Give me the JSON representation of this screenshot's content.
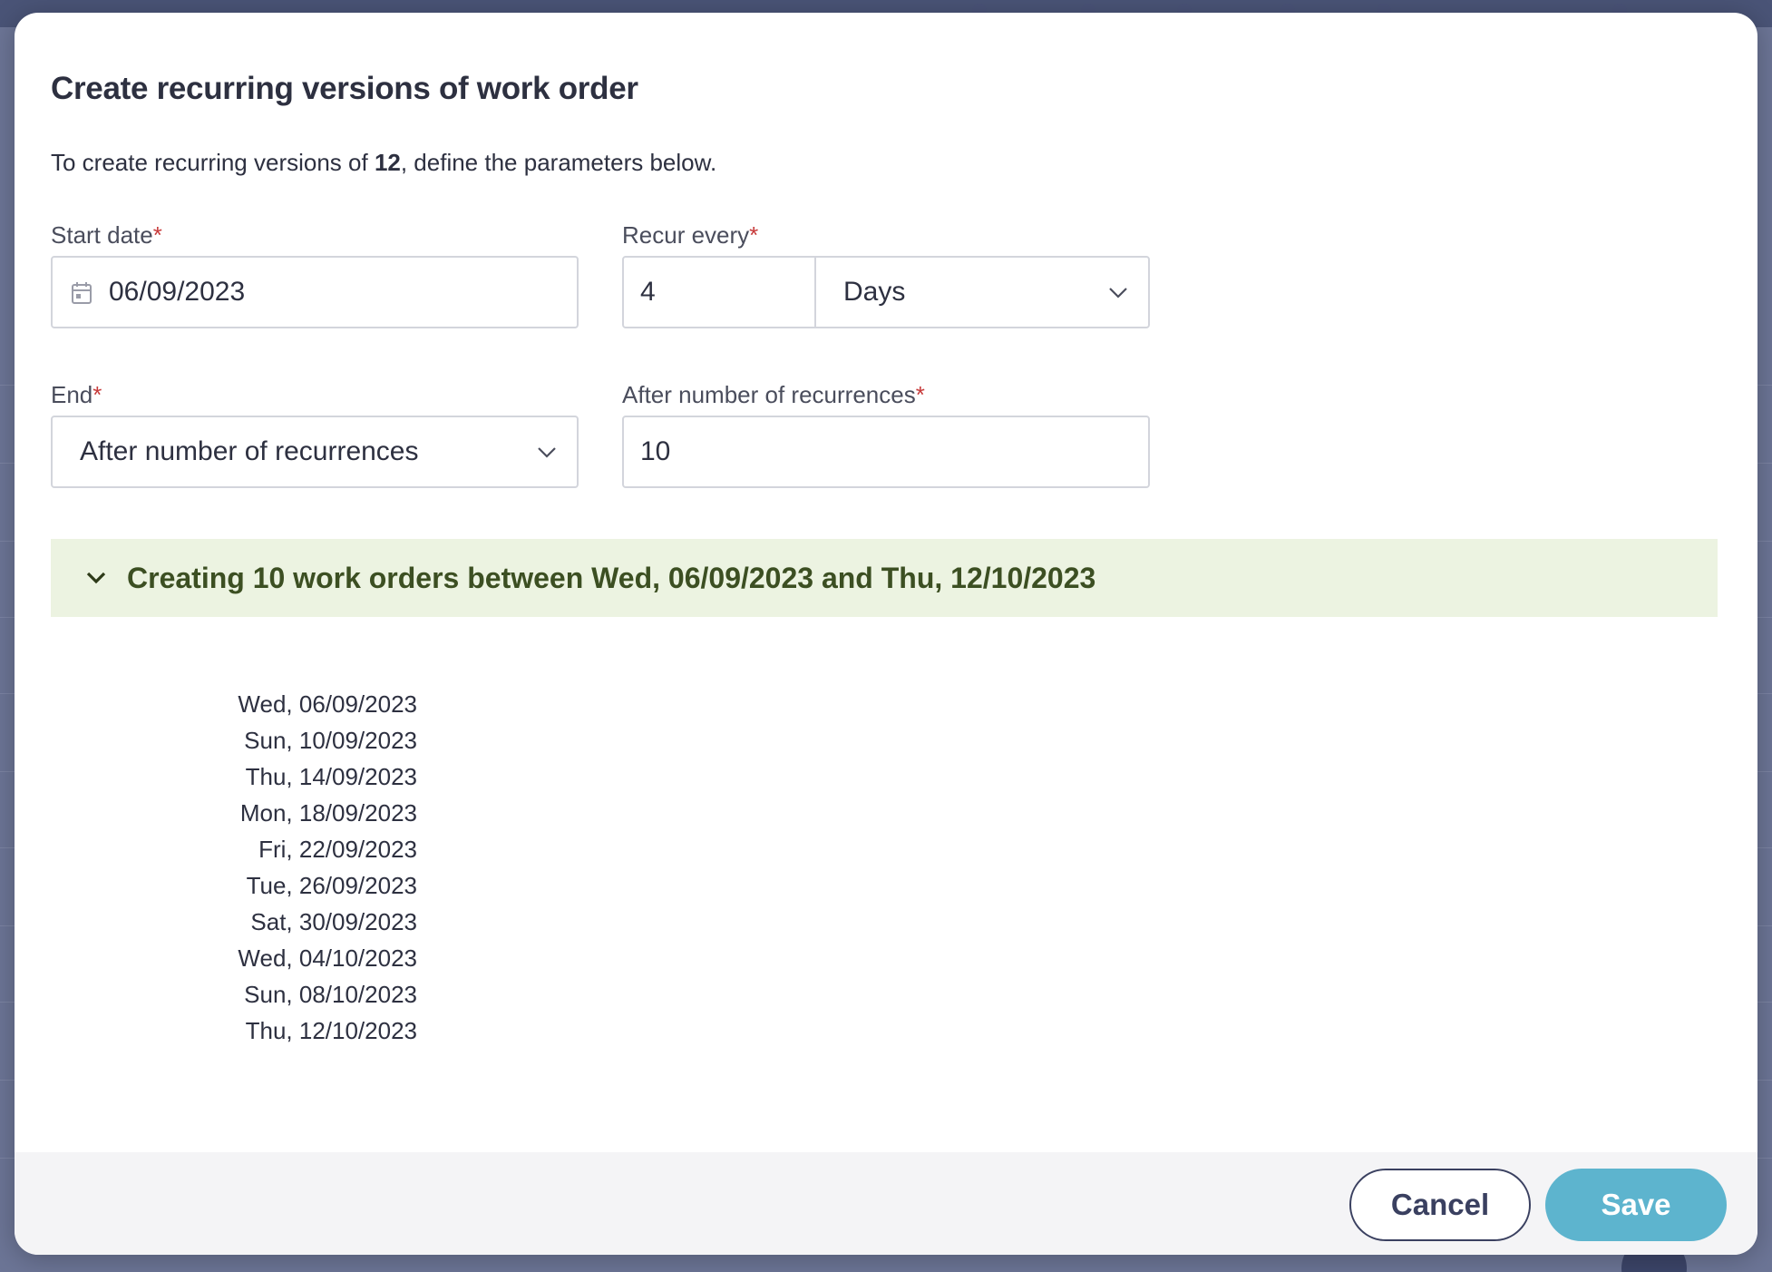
{
  "modal": {
    "title": "Create recurring versions of work order",
    "description_prefix": "To create recurring versions of ",
    "description_id": "12",
    "description_suffix": ", define the parameters below."
  },
  "form": {
    "start_date": {
      "label": "Start date",
      "required": "*",
      "value": "06/09/2023",
      "icon": "calendar-icon"
    },
    "recur_every": {
      "label": "Recur every",
      "required": "*",
      "value": "4",
      "unit": "Days",
      "icon": "chevron-down-icon"
    },
    "end": {
      "label": "End",
      "required": "*",
      "value": "After number of recurrences",
      "icon": "chevron-down-icon"
    },
    "recurrences": {
      "label": "After number of recurrences",
      "required": "*",
      "value": "10"
    }
  },
  "summary": {
    "text": "Creating 10 work orders between Wed, 06/09/2023 and Thu, 12/10/2023",
    "icon": "chevron-down-icon",
    "background": "#ecf3e1",
    "text_color": "#3c4f22"
  },
  "dates": [
    "Wed, 06/09/2023",
    "Sun, 10/09/2023",
    "Thu, 14/09/2023",
    "Mon, 18/09/2023",
    "Fri, 22/09/2023",
    "Tue, 26/09/2023",
    "Sat, 30/09/2023",
    "Wed, 04/10/2023",
    "Sun, 08/10/2023",
    "Thu, 12/10/2023"
  ],
  "buttons": {
    "cancel": "Cancel",
    "save": "Save"
  },
  "colors": {
    "accent": "#5db4ce",
    "required": "#c73a3a",
    "overlay": "#616a8c"
  }
}
